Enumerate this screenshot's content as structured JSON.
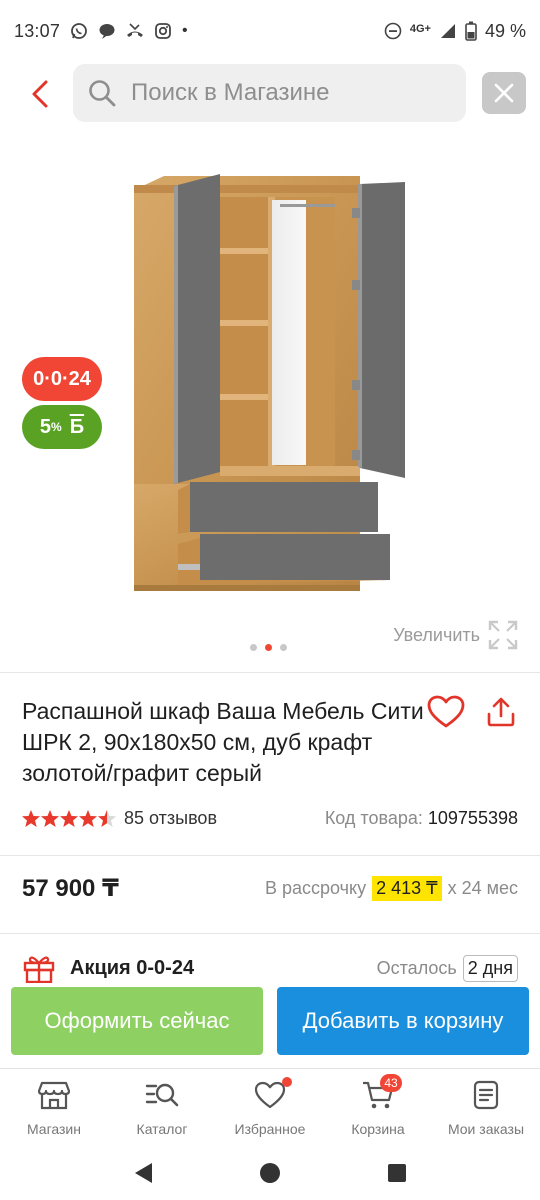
{
  "status_bar": {
    "time": "13:07",
    "dot": "•",
    "network": "4G+",
    "battery": "49 %",
    "icons": [
      "whatsapp-icon",
      "chat-icon",
      "missed-call-icon",
      "instagram-icon",
      "dnd-icon",
      "signal-icon",
      "battery-icon"
    ]
  },
  "search": {
    "placeholder": "Поиск в Магазине",
    "value": ""
  },
  "badges": {
    "promo": "0·0·24",
    "bonus_percent": "5",
    "bonus_sup": "%",
    "bonus_currency": "Б"
  },
  "gallery": {
    "enlarge_label": "Увеличить",
    "dots_count": 3,
    "active_dot": 1
  },
  "product": {
    "title": "Распашной шкаф Ваша Мебель Сити ШРК 2, 90x180x50 см, дуб крафт золотой/графит серый",
    "rating": 4.5,
    "reviews": "85 отзывов",
    "code_label": "Код товара:",
    "code_value": "109755398",
    "price": "57 900 ₸",
    "installment_label": "В рассрочку",
    "installment_amount": "2 413 ₸",
    "installment_term": "х 24 мес"
  },
  "promo": {
    "label": "Акция 0-0-24",
    "left_label": "Осталось",
    "days": "2 дня"
  },
  "actions": {
    "checkout": "Оформить сейчас",
    "add_to_cart": "Добавить в корзину"
  },
  "bottom_nav": {
    "items": [
      {
        "label": "Магазин",
        "icon": "store-icon"
      },
      {
        "label": "Каталог",
        "icon": "catalog-search-icon"
      },
      {
        "label": "Избранное",
        "icon": "heart-icon"
      },
      {
        "label": "Корзина",
        "icon": "cart-icon"
      },
      {
        "label": "Мои заказы",
        "icon": "orders-icon"
      }
    ],
    "cart_count": "43"
  },
  "colors": {
    "accent_red": "#f14635",
    "green": "#5aa224",
    "checkout_green": "#8ed162",
    "cart_blue": "#1a8fdd",
    "installment_yellow": "#ffe400"
  }
}
